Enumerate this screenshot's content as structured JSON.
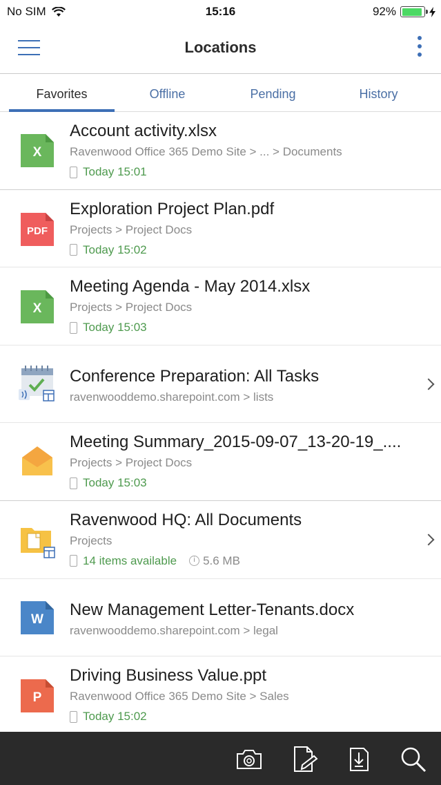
{
  "status": {
    "carrier": "No SIM",
    "time": "15:16",
    "battery_percent": "92%",
    "battery_level": 0.92,
    "battery_color": "#4cd964"
  },
  "nav": {
    "title": "Locations",
    "menu_icon": "hamburger-menu-icon",
    "more_icon": "vertical-dots-icon"
  },
  "tabs": [
    {
      "label": "Favorites",
      "active": true
    },
    {
      "label": "Offline",
      "active": false
    },
    {
      "label": "Pending",
      "active": false
    },
    {
      "label": "History",
      "active": false
    }
  ],
  "accent_color": "#3d6fb6",
  "items": [
    {
      "icon": "excel-file-icon",
      "badge": "X",
      "title": "Account activity.xlsx",
      "path": "Ravenwood Office 365 Demo Site > ... > Documents",
      "meta": "Today 15:01"
    },
    {
      "icon": "pdf-file-icon",
      "badge": "PDF",
      "title": "Exploration Project Plan.pdf",
      "path": "Projects > Project Docs",
      "meta": "Today 15:02"
    },
    {
      "icon": "excel-file-icon",
      "badge": "X",
      "title": "Meeting Agenda - May 2014.xlsx",
      "path": "Projects > Project Docs",
      "meta": "Today 15:03"
    },
    {
      "icon": "task-list-icon",
      "title": "Conference Preparation: All Tasks",
      "path": "ravenwooddemo.sharepoint.com > lists"
    },
    {
      "icon": "email-file-icon",
      "title": "Meeting Summary_2015-09-07_13-20-19_....",
      "path": "Projects > Project Docs",
      "meta": "Today 15:03"
    },
    {
      "icon": "document-library-icon",
      "title": "Ravenwood HQ: All Documents",
      "path": "Projects",
      "meta": "14 items available",
      "size": "5.6 MB"
    },
    {
      "icon": "word-file-icon",
      "badge": "W",
      "title": "New Management Letter-Tenants.docx",
      "path": "ravenwooddemo.sharepoint.com > legal"
    },
    {
      "icon": "powerpoint-file-icon",
      "badge": "P",
      "title": "Driving Business Value.ppt",
      "path": "Ravenwood Office 365 Demo Site > Sales",
      "meta": "Today 15:02"
    }
  ],
  "toolbar": [
    {
      "icon": "camera-icon"
    },
    {
      "icon": "edit-document-icon"
    },
    {
      "icon": "download-file-icon"
    },
    {
      "icon": "search-icon"
    }
  ]
}
